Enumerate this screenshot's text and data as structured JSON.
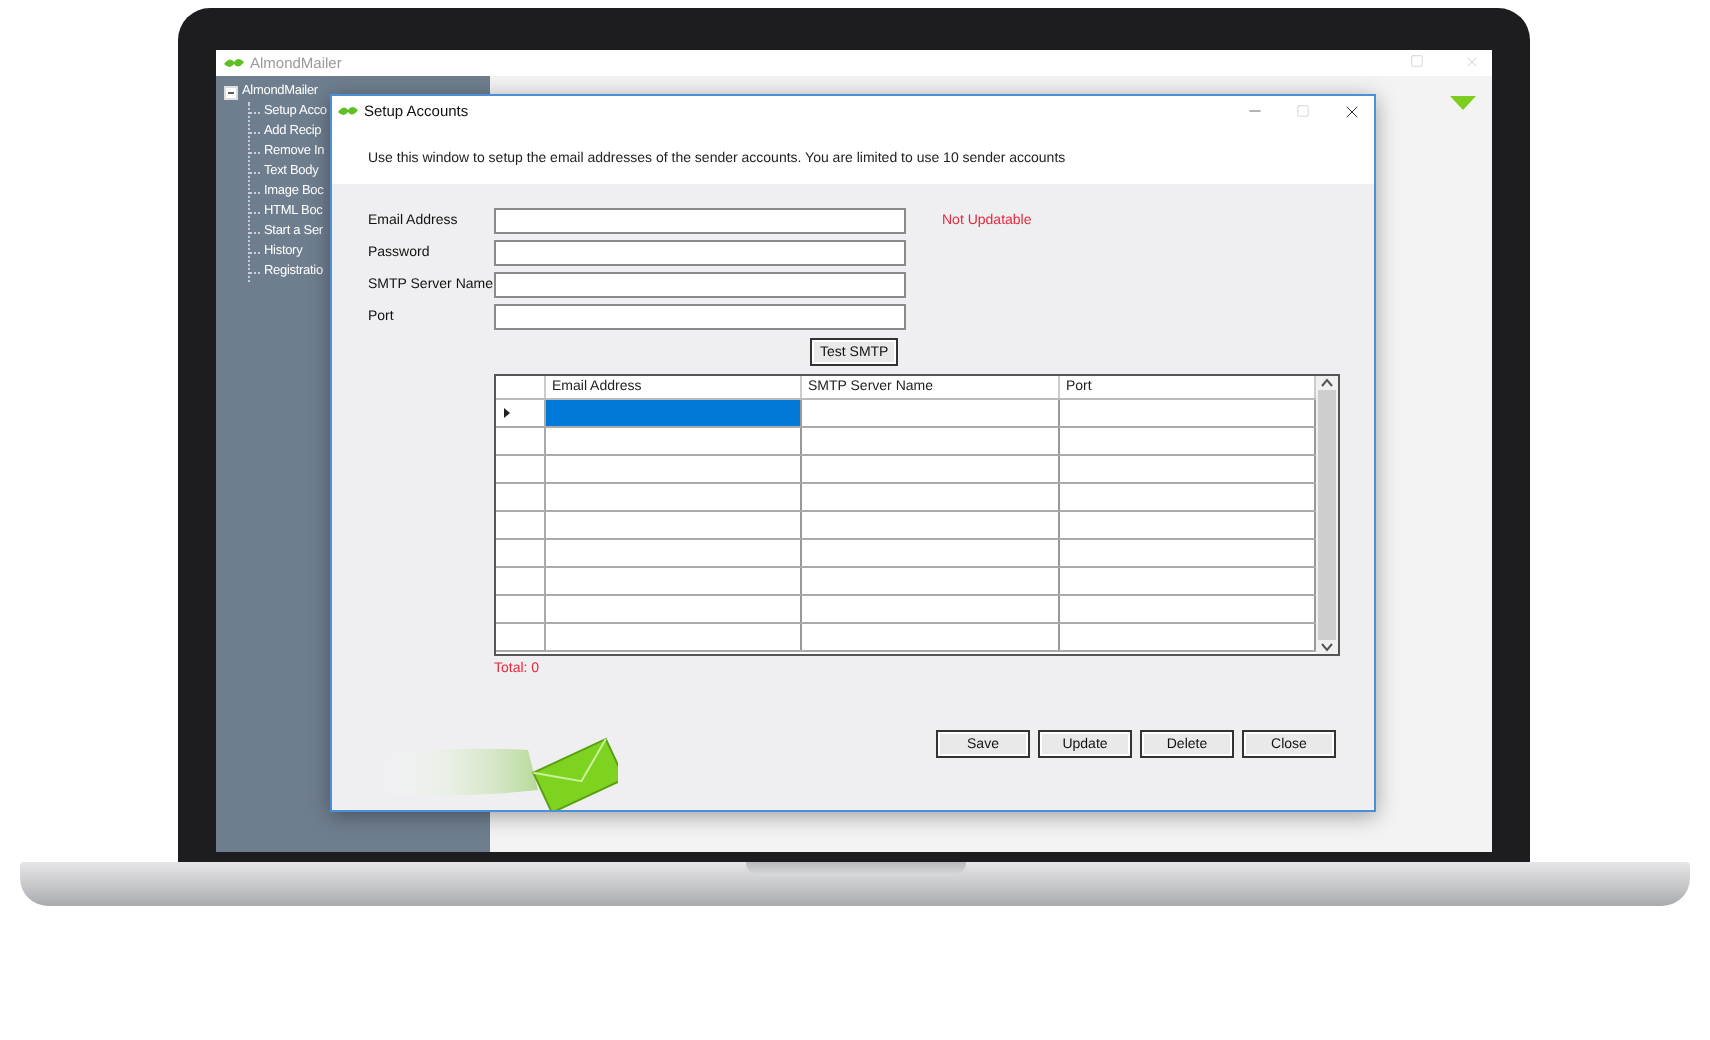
{
  "app": {
    "title": "AlmondMailer",
    "tree": {
      "label": "AlmondMailer",
      "expanded": true,
      "children": [
        {
          "label": "Setup Acco"
        },
        {
          "label": "Add Recip"
        },
        {
          "label": "Remove In"
        },
        {
          "label": "Text Body"
        },
        {
          "label": "Image Boc"
        },
        {
          "label": "HTML Boc"
        },
        {
          "label": "Start a Ser"
        },
        {
          "label": "History"
        },
        {
          "label": "Registratio"
        }
      ]
    }
  },
  "dialog": {
    "title": "Setup Accounts",
    "description": "Use this window to setup the email addresses of the sender accounts. You are limited to use 10 sender accounts",
    "fields": [
      {
        "label": "Email Address"
      },
      {
        "label": "Password"
      },
      {
        "label": "SMTP Server Name"
      },
      {
        "label": "Port"
      }
    ],
    "note": "Not Updatable",
    "test_button": "Test SMTP",
    "grid": {
      "columns": [
        "Email Address",
        "SMTP Server Name",
        "Port"
      ],
      "rows": [
        {
          "current": true
        },
        {
          "current": false
        },
        {
          "current": false
        },
        {
          "current": false
        },
        {
          "current": false
        },
        {
          "current": false
        },
        {
          "current": false
        },
        {
          "current": false
        },
        {
          "current": false
        }
      ]
    },
    "total": "Total: 0",
    "buttons": [
      "Save",
      "Update",
      "Delete",
      "Close"
    ]
  }
}
